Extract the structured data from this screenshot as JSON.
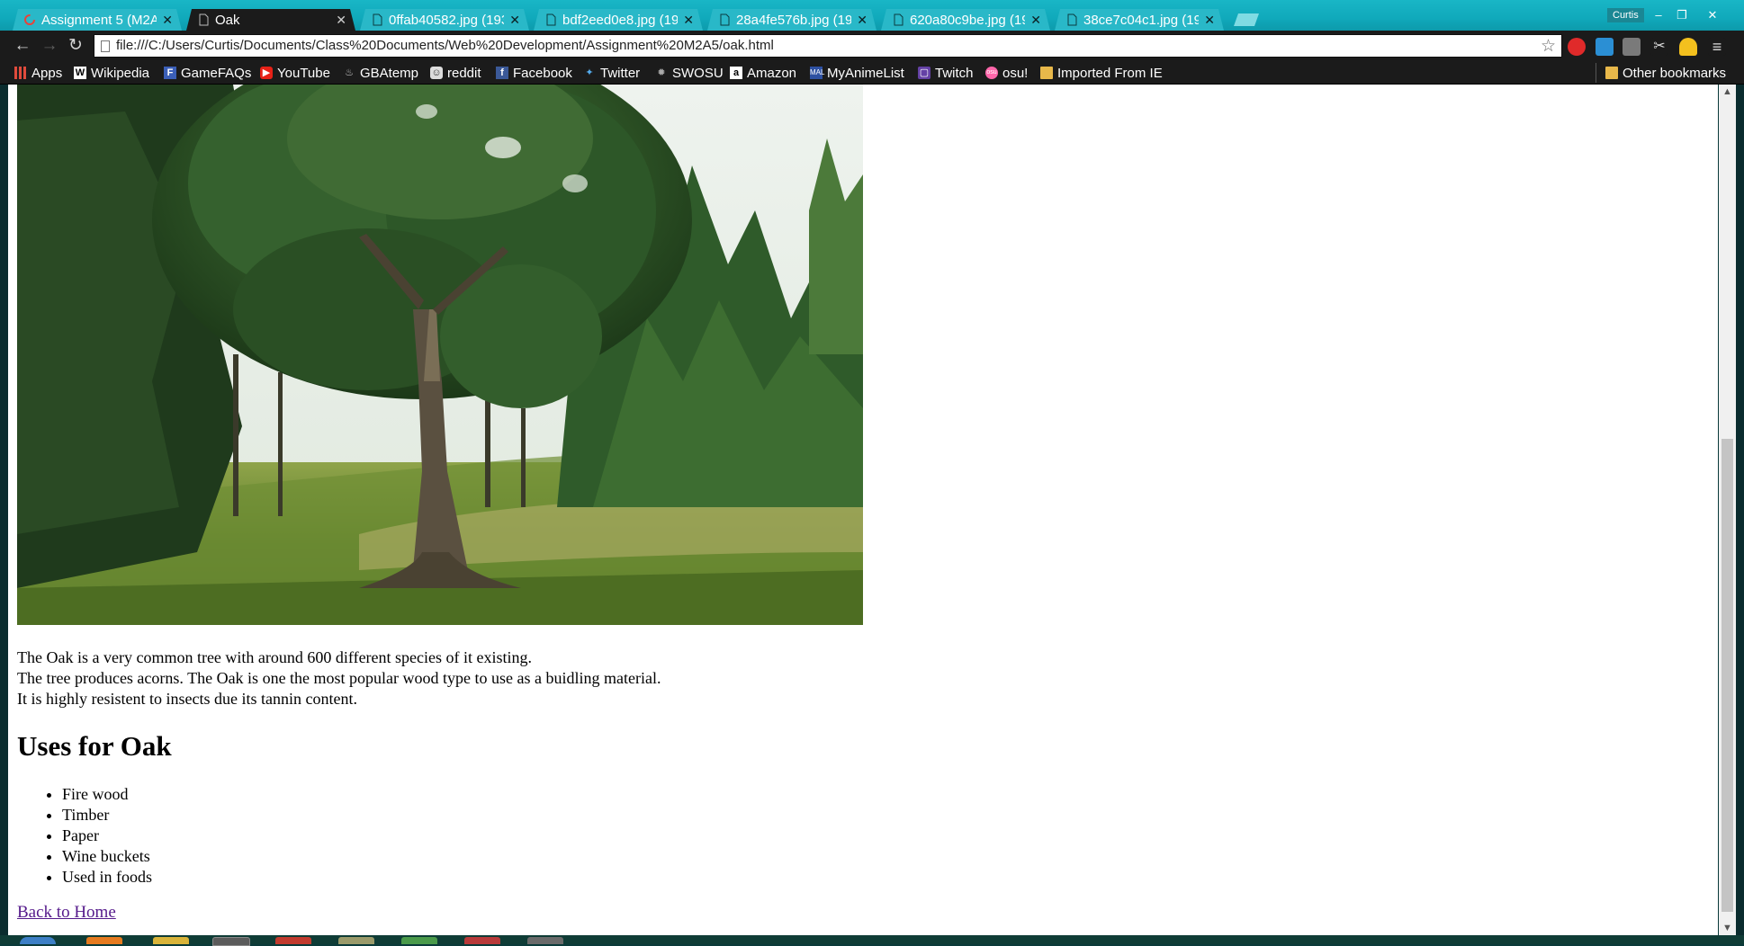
{
  "browser": {
    "tabs": [
      {
        "title": "Assignment 5 (M2A5",
        "icon": "loading-icon",
        "active": false
      },
      {
        "title": "Oak",
        "icon": "page-icon",
        "active": true
      },
      {
        "title": "0ffab40582.jpg (193",
        "icon": "page-icon",
        "active": false
      },
      {
        "title": "bdf2eed0e8.jpg (193",
        "icon": "page-icon",
        "active": false
      },
      {
        "title": "28a4fe576b.jpg (193",
        "icon": "page-icon",
        "active": false
      },
      {
        "title": "620a80c9be.jpg (193",
        "icon": "page-icon",
        "active": false
      },
      {
        "title": "38ce7c04c1.jpg (193",
        "icon": "page-icon",
        "active": false
      }
    ],
    "profile_name": "Curtis",
    "url": "file:///C:/Users/Curtis/Documents/Class%20Documents/Web%20Development/Assignment%20M2A5/oak.html",
    "bookmarks": [
      {
        "label": "Apps",
        "icon": "apps-grid-icon"
      },
      {
        "label": "Wikipedia",
        "icon": "wikipedia-icon"
      },
      {
        "label": "GameFAQs",
        "icon": "gamefaqs-icon"
      },
      {
        "label": "YouTube",
        "icon": "youtube-icon"
      },
      {
        "label": "GBAtemp",
        "icon": "gbatemp-icon"
      },
      {
        "label": "reddit",
        "icon": "reddit-icon"
      },
      {
        "label": "Facebook",
        "icon": "facebook-icon"
      },
      {
        "label": "Twitter",
        "icon": "twitter-icon"
      },
      {
        "label": "SWOSU",
        "icon": "swosu-icon"
      },
      {
        "label": "Amazon",
        "icon": "amazon-icon"
      },
      {
        "label": "MyAnimeList",
        "icon": "myanimelist-icon"
      },
      {
        "label": "Twitch",
        "icon": "twitch-icon"
      },
      {
        "label": "osu!",
        "icon": "osu-icon"
      },
      {
        "label": "Imported From IE",
        "icon": "folder-icon"
      }
    ],
    "other_bookmarks": "Other bookmarks",
    "colors": {
      "titlebar": "#10a9bb",
      "toolbar": "#1b1b1b",
      "link_visited": "#551a8b"
    }
  },
  "page": {
    "image_alt": "oak-tree-photo",
    "paragraph_lines": [
      "The Oak is a very common tree with around 600 different species of it existing.",
      "The tree produces acorns. The Oak is one the most popular wood type to use as a buidling material.",
      "It is highly resistent to insects due its tannin content."
    ],
    "uses_heading": "Uses for Oak",
    "uses": [
      "Fire wood",
      "Timber",
      "Paper",
      "Wine buckets",
      "Used in foods"
    ],
    "back_link": "Back to Home"
  }
}
